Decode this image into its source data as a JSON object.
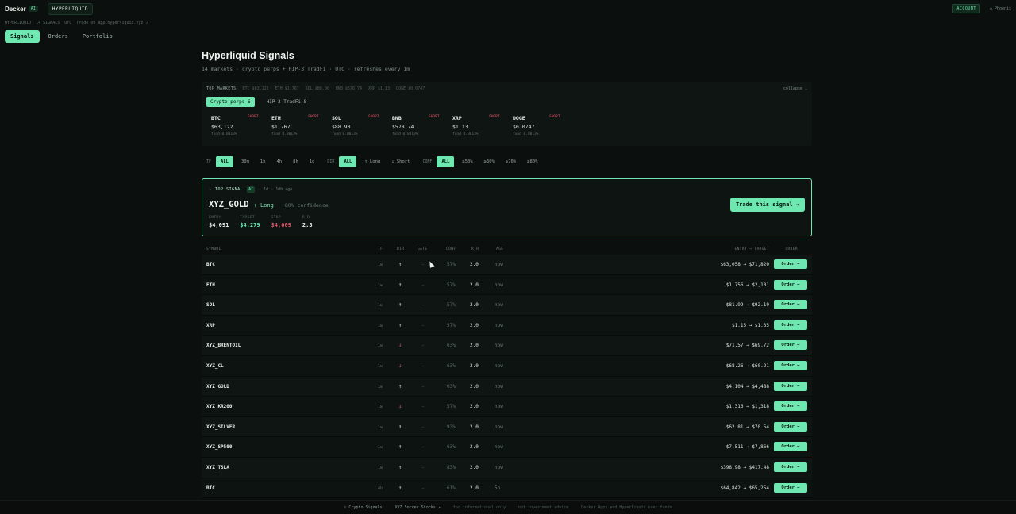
{
  "app": {
    "brand": "Decker",
    "brand_tag": "AI",
    "venue": "HYPERLIQUID",
    "account": "ACCOUNT",
    "user": "⌂ Phoenix"
  },
  "crumbs": [
    "HYPERLIQUID",
    "14 SIGNALS",
    "UTC",
    "Trade on app.hyperliquid.xyz ↗"
  ],
  "tabs": [
    {
      "label": "Signals",
      "active": true
    },
    {
      "label": "Orders",
      "active": false
    },
    {
      "label": "Portfolio",
      "active": false
    }
  ],
  "header": {
    "title": "Hyperliquid Signals",
    "subtitle": "14 markets · crypto perps + HIP-3 TradFi · UTC · refreshes every 1m"
  },
  "markets": {
    "label": "TOP MARKETS",
    "ticker": [
      "BTC $63,122",
      "ETH $1,767",
      "SOL $88.90",
      "BNB $578.74",
      "XRP $1.13",
      "DOGE $0.0747"
    ],
    "collapse": "collapse ⌄",
    "tabs": [
      {
        "label": "Crypto perps 6",
        "active": true
      },
      {
        "label": "HIP-3 TradFi 8",
        "active": false
      }
    ],
    "cards": [
      {
        "symbol": "BTC",
        "badge": "SHORT",
        "price": "$63,122",
        "funding": "fund 0.0013%"
      },
      {
        "symbol": "ETH",
        "badge": "SHORT",
        "price": "$1,767",
        "funding": "fund 0.0013%"
      },
      {
        "symbol": "SOL",
        "badge": "SHORT",
        "price": "$88.90",
        "funding": "fund 0.0013%"
      },
      {
        "symbol": "BNB",
        "badge": "SHORT",
        "price": "$578.74",
        "funding": "fund 0.0013%"
      },
      {
        "symbol": "XRP",
        "badge": "SHORT",
        "price": "$1.13",
        "funding": "fund 0.0013%"
      },
      {
        "symbol": "DOGE",
        "badge": "SHORT",
        "price": "$0.0747",
        "funding": "fund 0.0013%"
      }
    ]
  },
  "filters": {
    "tf_label": "TF",
    "tf": [
      {
        "label": "ALL",
        "active": true
      },
      {
        "label": "30m",
        "active": false
      },
      {
        "label": "1h",
        "active": false
      },
      {
        "label": "4h",
        "active": false
      },
      {
        "label": "8h",
        "active": false
      },
      {
        "label": "1d",
        "active": false
      }
    ],
    "dir_label": "DIR",
    "dir": [
      {
        "label": "ALL",
        "active": true
      },
      {
        "label": "↑ Long",
        "active": false
      },
      {
        "label": "↓ Short",
        "active": false
      }
    ],
    "conf_label": "CONF",
    "conf": [
      {
        "label": "ALL",
        "active": true
      },
      {
        "label": "≥50%",
        "active": false
      },
      {
        "label": "≥60%",
        "active": false
      },
      {
        "label": "≥70%",
        "active": false
      },
      {
        "label": "≥80%",
        "active": false
      }
    ]
  },
  "top_signal": {
    "label": "TOP SIGNAL",
    "badge": "AI",
    "meta": "· 1d · 10h ago",
    "symbol": "XYZ_GOLD",
    "direction": "↑ Long",
    "confidence": "80% confidence",
    "stats": [
      {
        "key": "ENTRY",
        "value": "$4,091",
        "tone": "default"
      },
      {
        "key": "TARGET",
        "value": "$4,279",
        "tone": "green"
      },
      {
        "key": "STOP",
        "value": "$4,009",
        "tone": "red"
      },
      {
        "key": "R:R",
        "value": "2.3",
        "tone": "default"
      }
    ],
    "button": "Trade this signal →"
  },
  "table": {
    "headers": {
      "symbol": "SYMBOL",
      "tf": "TF",
      "dir": "DIR",
      "gate": "GATE",
      "conf": "CONF",
      "rr": "R:R",
      "age": "AGE",
      "entry": "ENTRY → TARGET",
      "order": "ORDER"
    },
    "order_label": "Order →",
    "rows": [
      {
        "symbol": "BTC",
        "tf": "1w",
        "dir": "↑",
        "dir_type": "up",
        "gate": "-",
        "conf": "57%",
        "rr": "2.0",
        "age": "now",
        "entry": "$63,058 → $71,820"
      },
      {
        "symbol": "ETH",
        "tf": "1w",
        "dir": "↑",
        "dir_type": "up",
        "gate": "-",
        "conf": "57%",
        "rr": "2.0",
        "age": "now",
        "entry": "$1,756 → $2,101"
      },
      {
        "symbol": "SOL",
        "tf": "1w",
        "dir": "↑",
        "dir_type": "up",
        "gate": "-",
        "conf": "57%",
        "rr": "2.0",
        "age": "now",
        "entry": "$81.99 → $92.19"
      },
      {
        "symbol": "XRP",
        "tf": "1w",
        "dir": "↑",
        "dir_type": "up",
        "gate": "-",
        "conf": "57%",
        "rr": "2.0",
        "age": "now",
        "entry": "$1.15 → $1.35"
      },
      {
        "symbol": "XYZ_BRENTOIL",
        "tf": "1w",
        "dir": "↓",
        "dir_type": "down",
        "gate": "-",
        "conf": "63%",
        "rr": "2.0",
        "age": "now",
        "entry": "$71.57 → $69.72"
      },
      {
        "symbol": "XYZ_CL",
        "tf": "1w",
        "dir": "↓",
        "dir_type": "down",
        "gate": "-",
        "conf": "63%",
        "rr": "2.0",
        "age": "now",
        "entry": "$68.26 → $60.21"
      },
      {
        "symbol": "XYZ_GOLD",
        "tf": "1w",
        "dir": "↑",
        "dir_type": "up",
        "gate": "-",
        "conf": "63%",
        "rr": "2.0",
        "age": "now",
        "entry": "$4,104 → $4,488"
      },
      {
        "symbol": "XYZ_KR200",
        "tf": "1w",
        "dir": "↓",
        "dir_type": "down",
        "gate": "-",
        "conf": "57%",
        "rr": "2.0",
        "age": "now",
        "entry": "$1,316 → $1,318"
      },
      {
        "symbol": "XYZ_SILVER",
        "tf": "1w",
        "dir": "↑",
        "dir_type": "up",
        "gate": "-",
        "conf": "93%",
        "rr": "2.0",
        "age": "now",
        "entry": "$62.81 → $70.54"
      },
      {
        "symbol": "XYZ_SP500",
        "tf": "1w",
        "dir": "↑",
        "dir_type": "up",
        "gate": "-",
        "conf": "63%",
        "rr": "2.0",
        "age": "now",
        "entry": "$7,511 → $7,866"
      },
      {
        "symbol": "XYZ_TSLA",
        "tf": "1w",
        "dir": "↑",
        "dir_type": "up",
        "gate": "-",
        "conf": "83%",
        "rr": "2.0",
        "age": "now",
        "entry": "$398.98 → $417.48"
      },
      {
        "symbol": "BTC",
        "tf": "4h",
        "dir": "↑",
        "dir_type": "up",
        "gate": "-",
        "conf": "61%",
        "rr": "2.0",
        "age": "5h",
        "entry": "$64,842 → $65,254"
      }
    ]
  },
  "footer": [
    {
      "text": "↑ Crypto Signals",
      "highlight": true
    },
    {
      "text": "XYZ Soccer Stocks ↗",
      "highlight": true
    },
    {
      "text": "for informational only",
      "highlight": false
    },
    {
      "text": "not investment advice",
      "highlight": false
    },
    {
      "text": "Decker Apps and Hyperliquid user funds",
      "highlight": false
    }
  ],
  "colors": {
    "accent": "#6ee7b0",
    "short": "#e0566a",
    "background": "#0b0f0d"
  }
}
